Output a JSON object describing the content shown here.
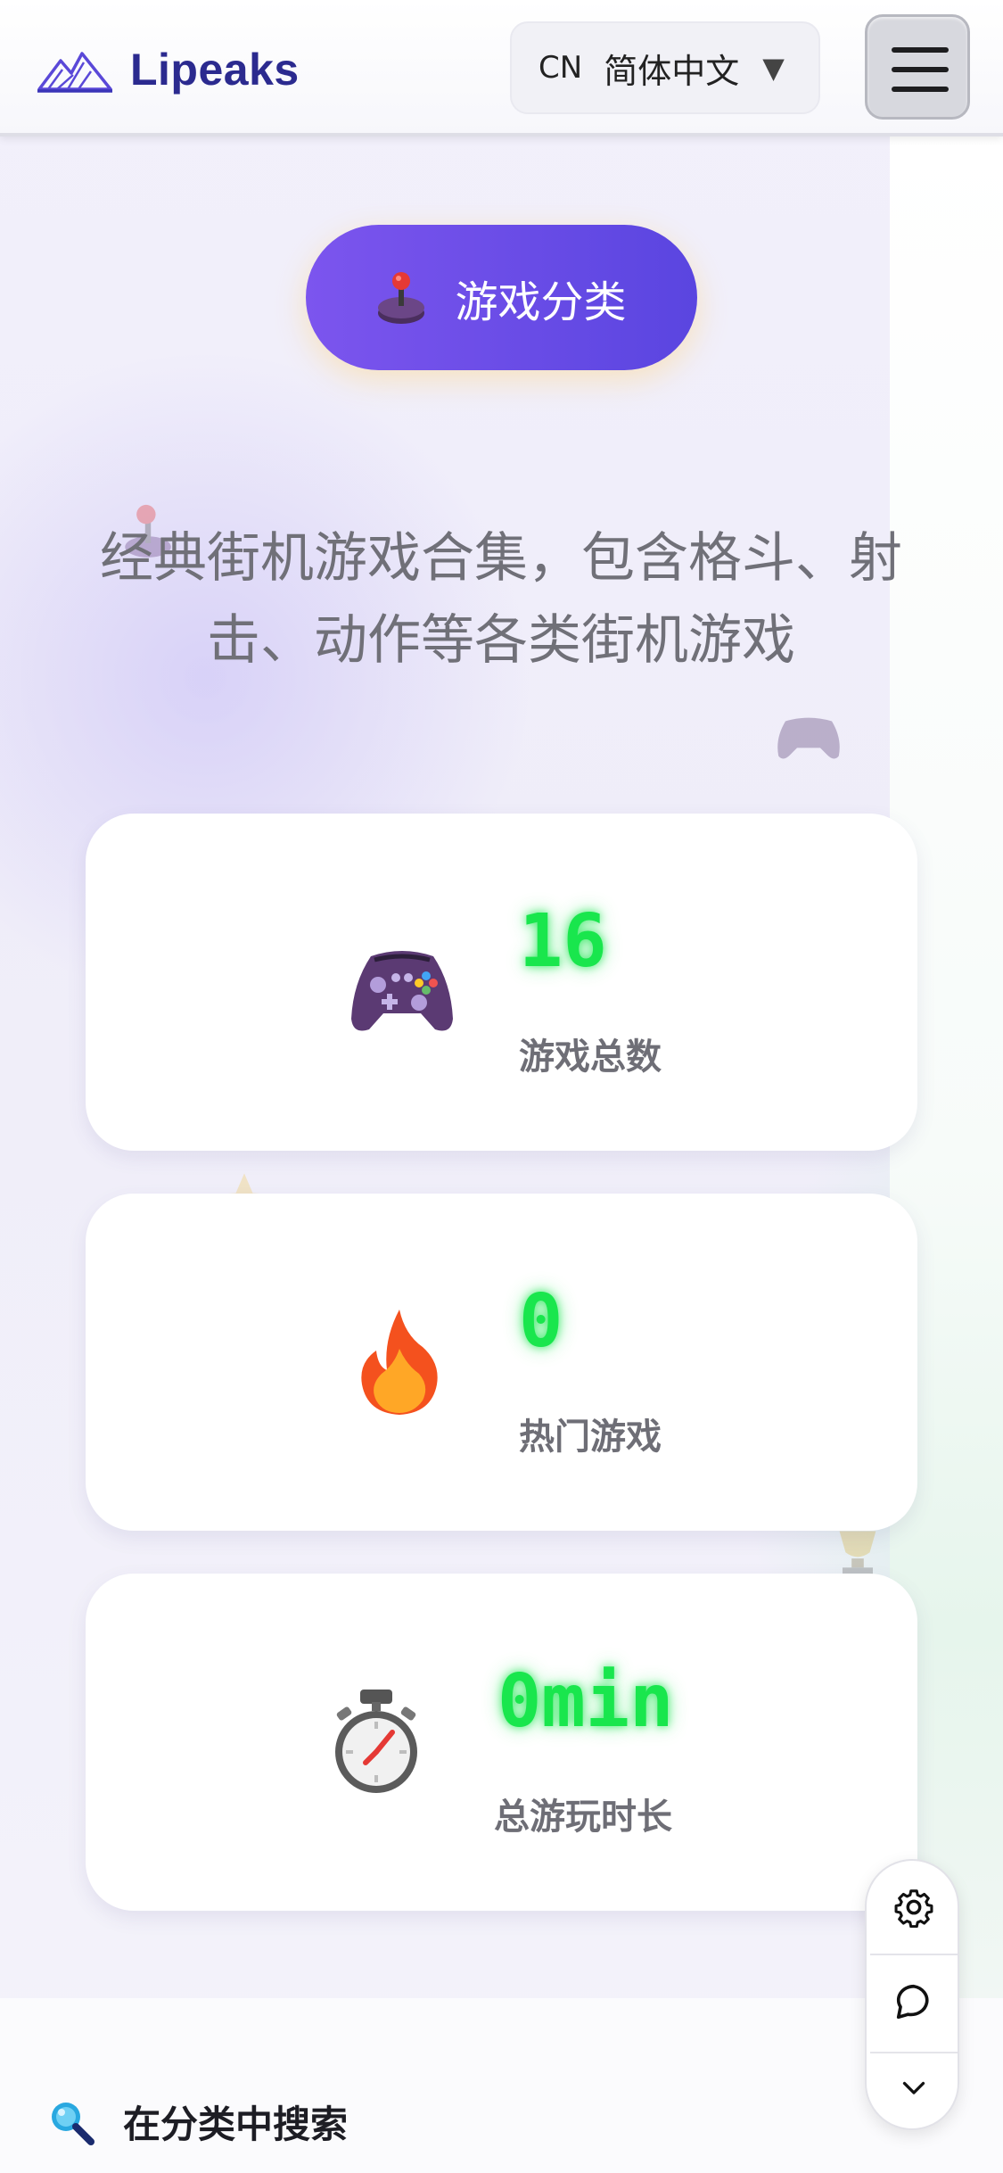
{
  "header": {
    "brand": "Lipeaks",
    "language": {
      "code": "CN",
      "name": "简体中文",
      "arrow": "▼"
    },
    "menu_icon": "hamburger-icon"
  },
  "category_button": {
    "label": "游戏分类",
    "icon": "joystick-icon"
  },
  "description": {
    "line1": "经典街机游戏合集，包含格斗、射",
    "line2": "击、动作等各类街机游戏"
  },
  "stats": [
    {
      "value": "16",
      "label": "游戏总数",
      "icon": "gamepad-icon"
    },
    {
      "value": "0",
      "label": "热门游戏",
      "icon": "fire-icon"
    },
    {
      "value": "0min",
      "label": "总游玩时长",
      "icon": "stopwatch-icon"
    }
  ],
  "float_menu": {
    "items": [
      "gear-icon",
      "chat-icon",
      "chevron-down-icon"
    ]
  },
  "search": {
    "label": "在分类中搜索",
    "icon": "magnifier-icon"
  },
  "colors": {
    "brand": "#2b2a8f",
    "accent_purple": "#6a4de8",
    "stat_value_green": "#19e64d",
    "label_gray": "#6e6e76"
  }
}
